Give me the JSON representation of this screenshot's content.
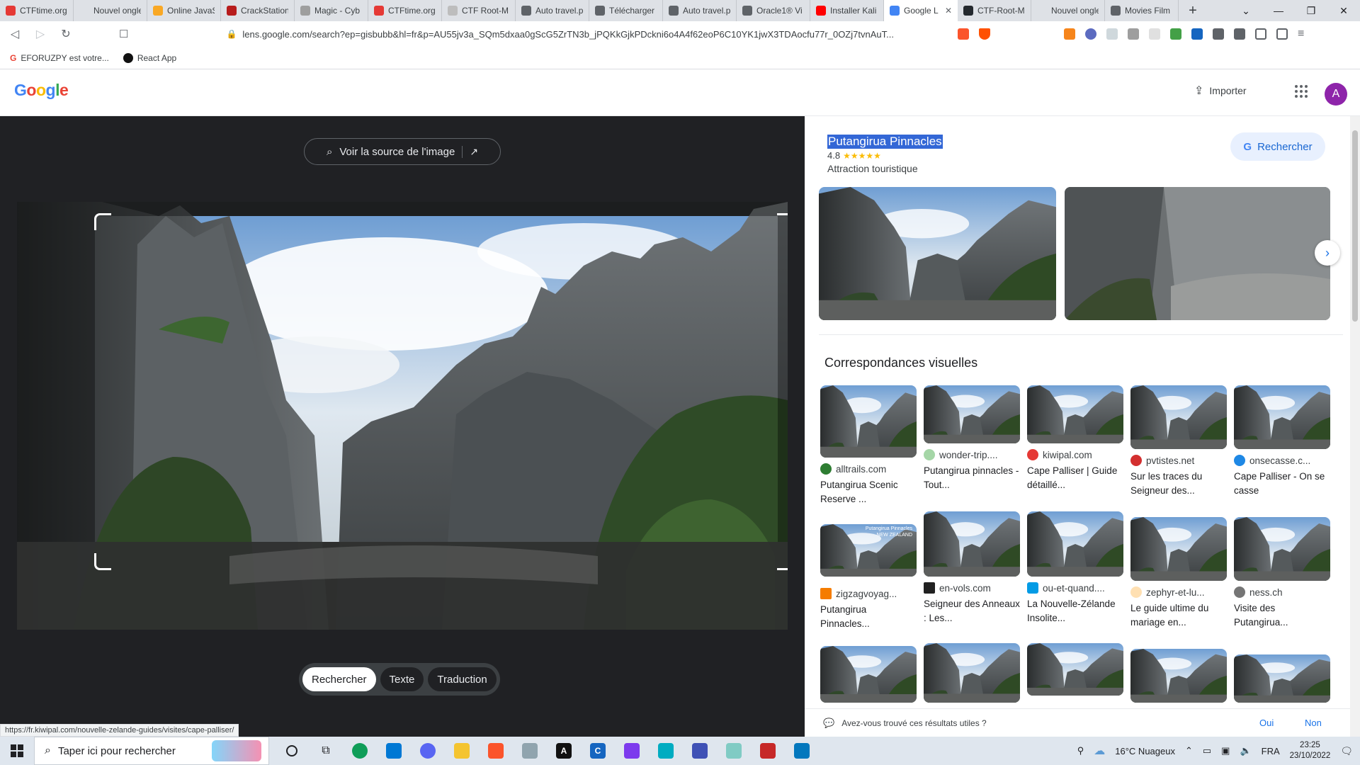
{
  "browser": {
    "tabs": [
      {
        "label": "CTFtime.org",
        "color": "#e53935"
      },
      {
        "label": "Nouvel onglet",
        "color": "#dee1e6"
      },
      {
        "label": "Online JavaS",
        "color": "#f9a825"
      },
      {
        "label": "CrackStation",
        "color": "#b71c1c"
      },
      {
        "label": "Magic - Cyb",
        "color": "#9e9e9e"
      },
      {
        "label": "CTFtime.org",
        "color": "#e53935"
      },
      {
        "label": "CTF Root-M",
        "color": "#bdbdbd"
      },
      {
        "label": "Auto travel.p",
        "color": "#5f6368"
      },
      {
        "label": "Télécharger",
        "color": "#5f6368"
      },
      {
        "label": "Auto travel.p",
        "color": "#5f6368"
      },
      {
        "label": "Oracle1® Vi",
        "color": "#5f6368"
      },
      {
        "label": "Installer Kali",
        "color": "#ff0000"
      },
      {
        "label": "Google L",
        "color": "#4285f4",
        "active": true
      },
      {
        "label": "CTF-Root-M",
        "color": "#24292e"
      },
      {
        "label": "Nouvel onglet",
        "color": "#dee1e6"
      },
      {
        "label": "Movies Film",
        "color": "#5f6368"
      }
    ],
    "url": "lens.google.com/search?ep=gisbubb&hl=fr&p=AU55jv3a_SQm5dxaa0gScG5ZrTN3b_jPQKkGjkPDckni6o4A4f62eoP6C10YK1jwX3TDAocfu77r_0OZj7tvnAuT...",
    "bookmarks": [
      "EFORUZPY est votre...",
      "React App"
    ],
    "status_url": "https://fr.kiwipal.com/nouvelle-zelande-guides/visites/cape-palliser/"
  },
  "google": {
    "logo": "Google",
    "import_label": "Importer",
    "avatar_letter": "A"
  },
  "lens": {
    "source_button": "Voir la source de l'image",
    "modes": [
      "Rechercher",
      "Texte",
      "Traduction"
    ],
    "active_mode": "Rechercher"
  },
  "knowledge": {
    "title": "Putangirua Pinnacles",
    "rating": "4.8",
    "stars": "★★★★★",
    "type": "Attraction touristique",
    "search_button": "Rechercher"
  },
  "visual_matches": {
    "title": "Correspondances visuelles",
    "items": [
      {
        "source": "alltrails.com",
        "caption": "Putangirua Scenic Reserve ...",
        "icon_color": "#2e7d32"
      },
      {
        "source": "wonder-trip....",
        "caption": "Putangirua pinnacles - Tout...",
        "icon_color": "#a5d6a7"
      },
      {
        "source": "kiwipal.com",
        "caption": "Cape Palliser | Guide détaillé...",
        "icon_color": "#e53935"
      },
      {
        "source": "pvtistes.net",
        "caption": "Sur les traces du Seigneur des...",
        "icon_color": "#d32f2f"
      },
      {
        "source": "onsecasse.c...",
        "caption": "Cape Palliser - On se casse",
        "icon_color": "#1e88e5"
      },
      {
        "source": "zigzagvoyag...",
        "caption": "Putangirua Pinnacles...",
        "icon_color": "#f57c00"
      },
      {
        "source": "en-vols.com",
        "caption": "Seigneur des Anneaux : Les...",
        "icon_color": "#212121"
      },
      {
        "source": "ou-et-quand....",
        "caption": "La Nouvelle-Zélande Insolite...",
        "icon_color": "#039be5"
      },
      {
        "source": "zephyr-et-lu...",
        "caption": "Le guide ultime du mariage en...",
        "icon_color": "#ffe0b2"
      },
      {
        "source": "ness.ch",
        "caption": "Visite des Putangirua...",
        "icon_color": "#757575"
      }
    ],
    "thumb_overlay_label": "Putangirua Pinnacles",
    "thumb_overlay_sub": "NEW ZEALAND"
  },
  "feedback": {
    "question": "Avez-vous trouvé ces résultats utiles ?",
    "yes": "Oui",
    "no": "Non"
  },
  "taskbar": {
    "search_placeholder": "Taper ici pour rechercher",
    "weather": "16°C  Nuageux",
    "lang": "FRA",
    "time": "23:25",
    "date": "23/10/2022"
  }
}
